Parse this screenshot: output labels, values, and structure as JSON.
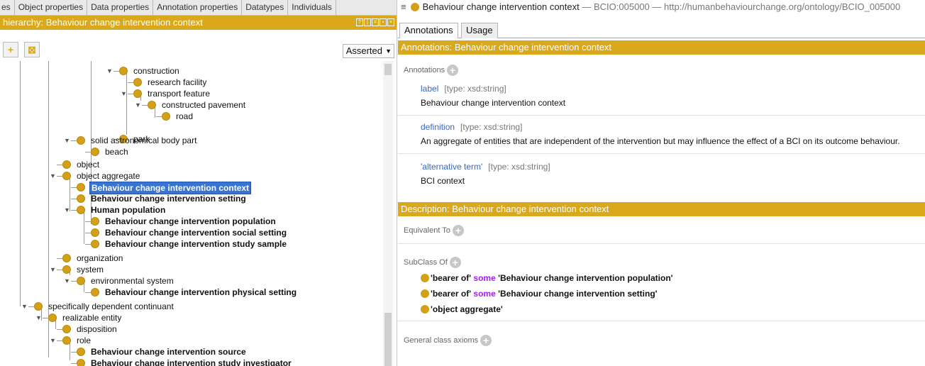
{
  "left_tabs": [
    "es",
    "Object properties",
    "Data properties",
    "Annotation properties",
    "Datatypes",
    "Individuals"
  ],
  "hierarchy": {
    "title": "hierarchy: Behaviour change intervention context",
    "view_mode": "Asserted"
  },
  "toolbar": {
    "add_sub": "+",
    "delete": "⊠"
  },
  "tree": [
    {
      "label": "construction",
      "bold": false
    },
    {
      "label": "research facility",
      "bold": false
    },
    {
      "label": "transport feature",
      "bold": false
    },
    {
      "label": "constructed pavement",
      "bold": false
    },
    {
      "label": "road",
      "bold": false
    },
    {
      "label": "park",
      "bold": false
    },
    {
      "label": "solid astronomical body part",
      "bold": false
    },
    {
      "label": "beach",
      "bold": false
    },
    {
      "label": "object",
      "bold": false
    },
    {
      "label": "object aggregate",
      "bold": false
    },
    {
      "label": "Behaviour change intervention context",
      "bold": true
    },
    {
      "label": "Behaviour change intervention setting",
      "bold": true
    },
    {
      "label": "Human population",
      "bold": true
    },
    {
      "label": "Behaviour change intervention population",
      "bold": true
    },
    {
      "label": "Behaviour change intervention social setting",
      "bold": true
    },
    {
      "label": "Behaviour change intervention study sample",
      "bold": true
    },
    {
      "label": "organization",
      "bold": false
    },
    {
      "label": "system",
      "bold": false
    },
    {
      "label": "environmental system",
      "bold": false
    },
    {
      "label": "Behaviour change intervention physical setting",
      "bold": true
    },
    {
      "label": "specifically dependent continuant",
      "bold": false
    },
    {
      "label": "realizable entity",
      "bold": false
    },
    {
      "label": "disposition",
      "bold": false
    },
    {
      "label": "role",
      "bold": false
    },
    {
      "label": "Behaviour change intervention source",
      "bold": true
    },
    {
      "label": "Behaviour change intervention study investigator",
      "bold": true
    }
  ],
  "entity_header": {
    "menu": "≡",
    "name": "Behaviour change intervention context",
    "sep1": "—",
    "id": "BCIO:005000",
    "sep2": "—",
    "iri": "http://humanbehaviourchange.org/ontology/BCIO_005000"
  },
  "right_tabs": [
    "Annotations",
    "Usage"
  ],
  "annotations": {
    "title": "Annotations: Behaviour change intervention context",
    "section_label": "Annotations",
    "items": [
      {
        "key": "label",
        "type": "[type: xsd:string]",
        "value": "Behaviour change intervention context"
      },
      {
        "key": "definition",
        "type": "[type: xsd:string]",
        "value": "An aggregate of entities that are independent of the intervention but may influence the effect of a BCI on its outcome behaviour."
      },
      {
        "key": "'alternative term'",
        "type": "[type: xsd:string]",
        "value": "BCI context"
      }
    ]
  },
  "description": {
    "title": "Description: Behaviour change intervention context",
    "equivalent_to": "Equivalent To",
    "subclass_of": "SubClass Of",
    "general_axioms": "General class axioms",
    "axioms": [
      {
        "a": "'bearer of'",
        "kw": "some",
        "b": "'Behaviour change intervention population'"
      },
      {
        "a": "'bearer of'",
        "kw": "some",
        "b": "'Behaviour change intervention setting'"
      },
      {
        "a": "'object aggregate'",
        "kw": "",
        "b": ""
      }
    ]
  },
  "colors": {
    "accent": "#d9a81c",
    "selection": "#3874d0",
    "keyword": "#a020f0",
    "link": "#3366cc"
  }
}
